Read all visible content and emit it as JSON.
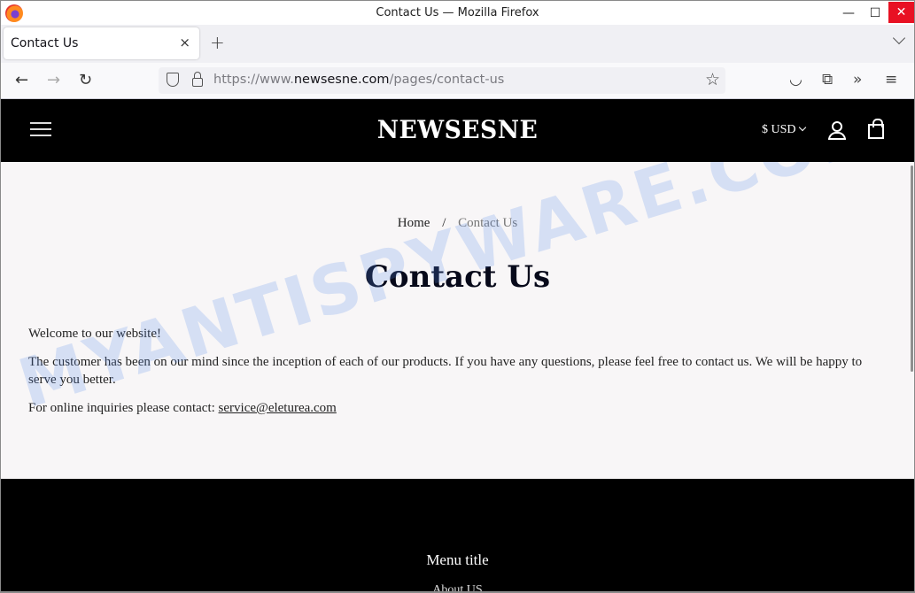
{
  "window": {
    "title": "Contact Us — Mozilla Firefox",
    "minimize_glyph": "—",
    "maximize_glyph": "☐",
    "close_glyph": "✕"
  },
  "tabs": [
    {
      "label": "Contact Us",
      "close_glyph": "×",
      "active": true
    }
  ],
  "tabbar": {
    "new_tab_glyph": "+"
  },
  "navbar": {
    "back_glyph": "←",
    "forward_glyph": "→",
    "reload_glyph": "↻",
    "url_scheme": "https://www.",
    "url_host": "newsesne.com",
    "url_path": "/pages/contact-us",
    "bookmark_glyph": "☆",
    "pocket_glyph": "◡",
    "extensions_glyph": "⧉",
    "overflow_glyph": "»",
    "menu_glyph": "≡"
  },
  "site_header": {
    "logo": "NEWSESNE",
    "currency": "$ USD"
  },
  "main": {
    "breadcrumb": {
      "home": "Home",
      "separator": "/",
      "current": "Contact Us"
    },
    "title": "Contact Us",
    "paragraphs": {
      "welcome": "Welcome to our website!",
      "body": "The customer has been on our mind since the inception of each of our products. If you have any questions, please feel free to contact us. We will be happy to serve you better.",
      "inquiry_prefix": "For online inquiries please contact: ",
      "email": "service@eleturea.com"
    },
    "watermark": "MYANTISPYWARE.COM"
  },
  "footer": {
    "menu_title": "Menu title",
    "links": [
      "About US"
    ]
  },
  "colors": {
    "header_bg": "#000000",
    "content_bg": "#f8f6f7",
    "close_button": "#e81123"
  }
}
